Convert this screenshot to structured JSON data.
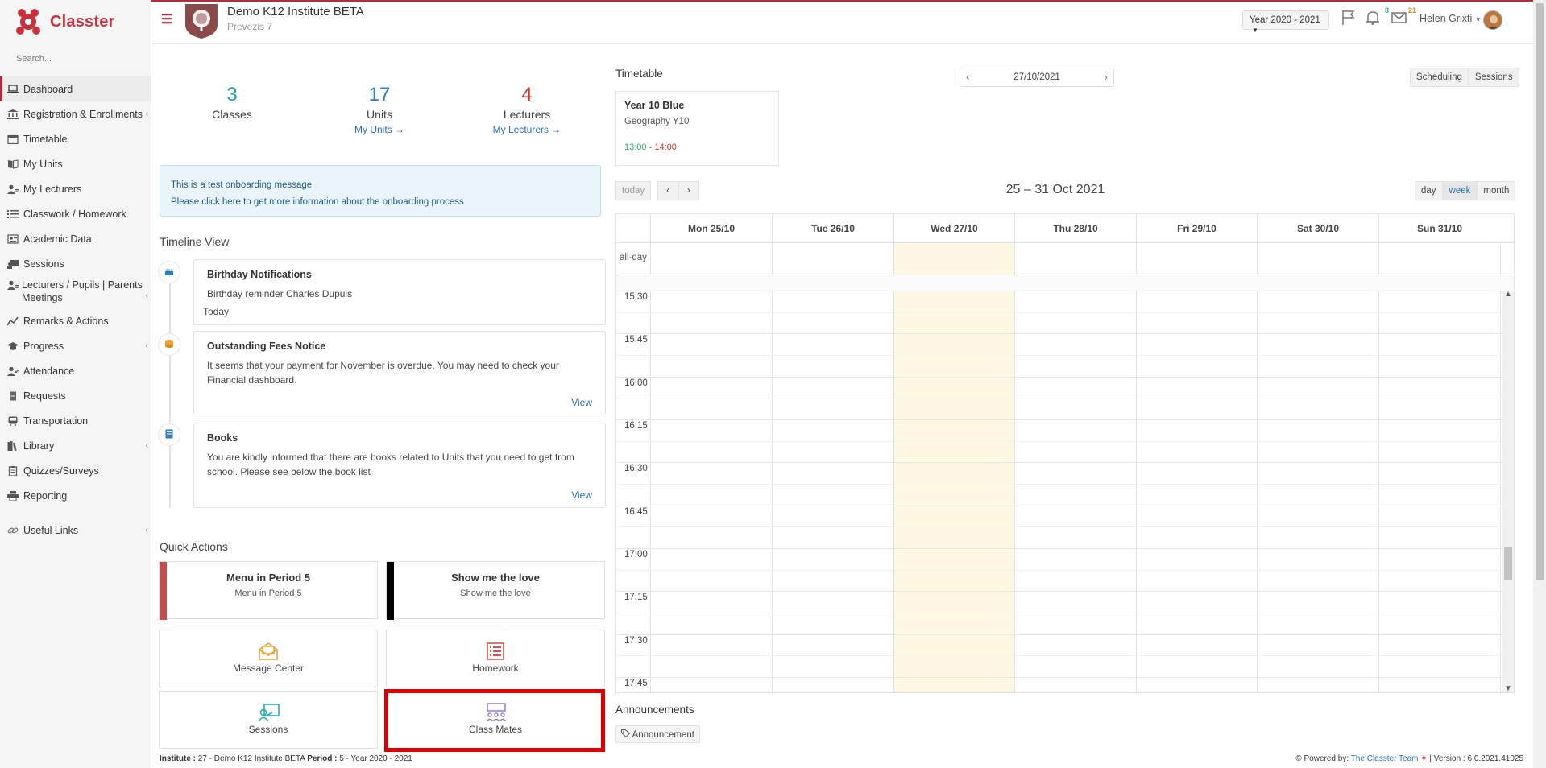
{
  "app": {
    "logo_text": "Classter",
    "search_placeholder": "Search..."
  },
  "sidebar": {
    "items": [
      {
        "label": "Dashboard",
        "icon": "laptop-icon"
      },
      {
        "label": "Registration & Enrollments",
        "icon": "institution-icon"
      },
      {
        "label": "Timetable",
        "icon": "calendar-icon"
      },
      {
        "label": "My Units",
        "icon": "book-icon"
      },
      {
        "label": "My Lecturers",
        "icon": "users-icon"
      },
      {
        "label": "Classwork / Homework",
        "icon": "list-icon"
      },
      {
        "label": "Academic Data",
        "icon": "id-card-icon"
      },
      {
        "label": "Sessions",
        "icon": "chalkboard-icon"
      },
      {
        "label": "Lecturers / Pupils | Parents Meetings",
        "icon": "users-icon"
      },
      {
        "label": "Remarks & Actions",
        "icon": "chart-line-icon"
      },
      {
        "label": "Progress",
        "icon": "graduation-cap-icon"
      },
      {
        "label": "Attendance",
        "icon": "user-check-icon"
      },
      {
        "label": "Requests",
        "icon": "document-icon"
      },
      {
        "label": "Transportation",
        "icon": "bus-icon"
      },
      {
        "label": "Library",
        "icon": "books-icon"
      },
      {
        "label": "Quizzes/Surveys",
        "icon": "clipboard-icon"
      },
      {
        "label": "Reporting",
        "icon": "printer-icon"
      }
    ],
    "useful_links": "Useful Links"
  },
  "header": {
    "institute_name": "Demo K12 Institute BETA",
    "institute_sub": "Prevezis 7",
    "year_select": "Year 2020 - 2021",
    "notifications_count": "8",
    "messages_count": "21",
    "user_name": "Helen Grixti"
  },
  "stats": {
    "classes": {
      "value": "3",
      "label": "Classes"
    },
    "units": {
      "value": "17",
      "label": "Units",
      "link": "My Units"
    },
    "lecturers": {
      "value": "4",
      "label": "Lecturers",
      "link": "My Lecturers"
    }
  },
  "onboarding": {
    "line1": "This is a test onboarding message",
    "line2": "Please click here to get more information about the onboarding process"
  },
  "timeline": {
    "title": "Timeline View",
    "items": [
      {
        "title": "Birthday Notifications",
        "text": "Birthday reminder Charles Dupuis",
        "meta": "Today"
      },
      {
        "title": "Outstanding Fees Notice",
        "text": "It seems that your payment for November is overdue. You may need to check your Financial dashboard.",
        "link": "View"
      },
      {
        "title": "Books",
        "text": "You are kindly informed that there are books related to Units that you need to get from school. Please see below the book list",
        "link": "View"
      }
    ]
  },
  "quick_actions": {
    "title": "Quick Actions",
    "tiles": [
      {
        "title": "Menu in Period 5",
        "subtitle": "Menu in Period 5",
        "color": "#c0504d"
      },
      {
        "title": "Show me the love",
        "subtitle": "Show me the love",
        "color": "#000000"
      },
      {
        "label": "Message Center",
        "icon": "envelope-open-icon",
        "color": "#f0a030"
      },
      {
        "label": "Homework",
        "icon": "list-alt-icon",
        "color": "#d9534f"
      },
      {
        "label": "Sessions",
        "icon": "chalkboard-teacher-icon",
        "color": "#20b2aa"
      },
      {
        "label": "Class Mates",
        "icon": "classroom-icon",
        "color": "#8a6fd1"
      }
    ]
  },
  "footer": {
    "institute_label": "Institute :",
    "institute_value": "27 - Demo K12 Institute BETA",
    "period_label": "Period :",
    "period_value": "5 - Year 2020 - 2021",
    "powered_by": "Powered by:",
    "team": "The Classter Team",
    "version": "| Version : 6.0.2021.41025"
  },
  "timetable": {
    "title": "Timetable",
    "date": "27/10/2021",
    "buttons": [
      "Scheduling",
      "Sessions"
    ],
    "lesson": {
      "title": "Year 10 Blue",
      "subject": "Geography Y10",
      "start": "13:00",
      "end": "14:00"
    }
  },
  "calendar": {
    "today_btn": "today",
    "range": "25 – 31 Oct 2021",
    "views": [
      "day",
      "week",
      "month"
    ],
    "active_view": "week",
    "days": [
      "Mon 25/10",
      "Tue 26/10",
      "Wed 27/10",
      "Thu 28/10",
      "Fri 29/10",
      "Sat 30/10",
      "Sun 31/10"
    ],
    "allday_label": "all-day",
    "slots": [
      "15:30",
      "15:45",
      "16:00",
      "16:15",
      "16:30",
      "16:45",
      "17:00",
      "17:15",
      "17:30",
      "17:45"
    ]
  },
  "announcements": {
    "title": "Announcements",
    "tag": "Announcement"
  },
  "colors": {
    "brand": "#b5293a",
    "link": "#2a6ebb",
    "stat_teal": "#17a2a2",
    "stat_blue": "#2a7ec2",
    "stat_red": "#c0392b",
    "time_start": "#27ae60",
    "time_end": "#c0392b"
  }
}
